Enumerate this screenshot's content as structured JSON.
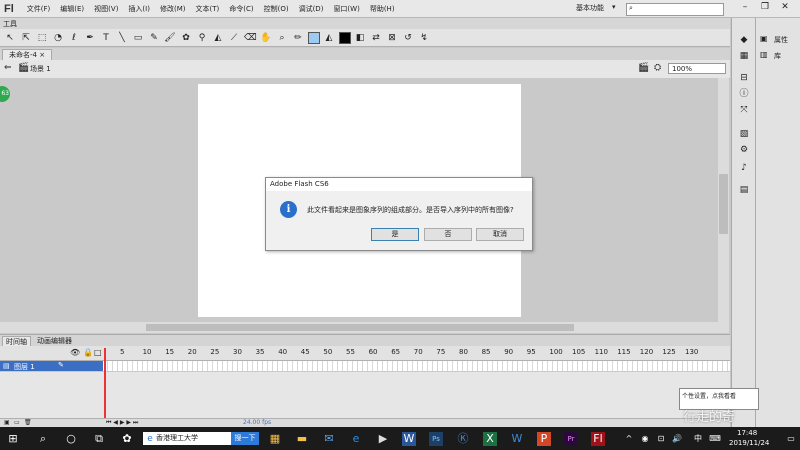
{
  "app": {
    "logo": "Fl",
    "workspace": "基本功能",
    "search_placeholder": ""
  },
  "menu": [
    "文件(F)",
    "编辑(E)",
    "视图(V)",
    "插入(I)",
    "修改(M)",
    "文本(T)",
    "命令(C)",
    "控制(O)",
    "调试(D)",
    "窗口(W)",
    "帮助(H)"
  ],
  "tools_label": "工具",
  "doc_tab": "未命名-4 ×",
  "scene": {
    "label": "场景 1",
    "zoom": "100%"
  },
  "badge": "63",
  "dialog": {
    "title": "Adobe Flash CS6",
    "icon_label": "i",
    "message": "此文件看起来是图象序列的组成部分。是否导入序列中的所有图像?",
    "yes": "是",
    "no": "否",
    "cancel": "取消"
  },
  "timeline": {
    "tabs": [
      "时间轴",
      "动画编辑器"
    ],
    "layer": "图层 1",
    "frame_numbers": [
      "5",
      "10",
      "15",
      "20",
      "25",
      "30",
      "35",
      "40",
      "45",
      "50",
      "55",
      "60",
      "65",
      "70",
      "75",
      "80",
      "85",
      "90",
      "95",
      "100",
      "105",
      "110",
      "115",
      "120",
      "125",
      "130"
    ],
    "fps": "24.00 fps"
  },
  "right_panel": {
    "properties": "属性",
    "library": "库"
  },
  "tooltip": "个性设置，点我看看",
  "watermark": "行走的奇",
  "taskbar": {
    "search_text": "香港理工大学",
    "search_button": "搜一下",
    "ime": "中",
    "time": "17:48",
    "date": "2019/11/24"
  }
}
